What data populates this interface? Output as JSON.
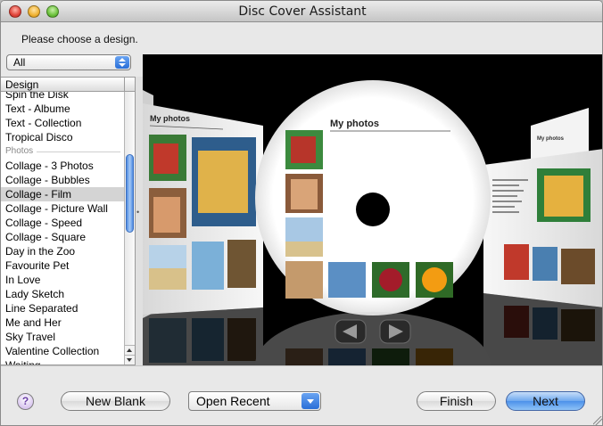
{
  "window": {
    "title": "Disc Cover Assistant"
  },
  "prompt": "Please choose a design.",
  "filter": {
    "selected": "All"
  },
  "design_list": {
    "header": "Design",
    "items": [
      {
        "label": "Spin the Disk",
        "type": "item"
      },
      {
        "label": "Text - Albume",
        "type": "item"
      },
      {
        "label": "Text - Collection",
        "type": "item"
      },
      {
        "label": "Tropical Disco",
        "type": "item"
      },
      {
        "label": "Photos",
        "type": "group"
      },
      {
        "label": "Collage - 3 Photos",
        "type": "item"
      },
      {
        "label": "Collage - Bubbles",
        "type": "item"
      },
      {
        "label": "Collage - Film",
        "type": "item",
        "selected": true
      },
      {
        "label": "Collage - Picture Wall",
        "type": "item"
      },
      {
        "label": "Collage - Speed",
        "type": "item"
      },
      {
        "label": "Collage - Square",
        "type": "item"
      },
      {
        "label": "Day in the Zoo",
        "type": "item"
      },
      {
        "label": "Favourite Pet",
        "type": "item"
      },
      {
        "label": "In Love",
        "type": "item"
      },
      {
        "label": "Lady Sketch",
        "type": "item"
      },
      {
        "label": "Line Separated",
        "type": "item"
      },
      {
        "label": "Me and Her",
        "type": "item"
      },
      {
        "label": "Sky Travel",
        "type": "item"
      },
      {
        "label": "Valentine Collection",
        "type": "item"
      },
      {
        "label": "Waiting",
        "type": "item"
      }
    ]
  },
  "preview": {
    "left_card_title": "My photos",
    "disc_title": "My photos",
    "right_card_title": "My photos"
  },
  "buttons": {
    "help": "?",
    "new_blank": "New Blank",
    "open_recent": "Open Recent",
    "finish": "Finish",
    "next": "Next"
  },
  "colors": {
    "accent": "#4c91ea",
    "selection": "#d4d4d4",
    "preview_bg": "#000000"
  }
}
